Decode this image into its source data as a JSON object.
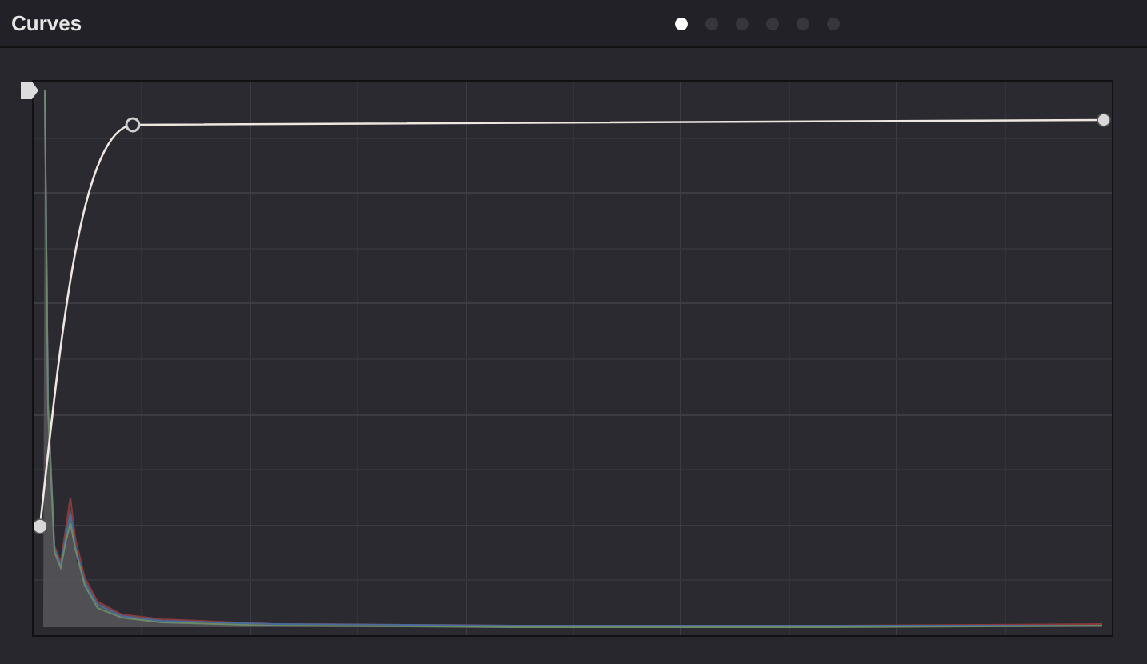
{
  "panel": {
    "title": "Curves"
  },
  "pages": [
    {
      "selected": true
    },
    {
      "selected": false
    },
    {
      "selected": false
    },
    {
      "selected": false
    },
    {
      "selected": false
    },
    {
      "selected": false
    }
  ]
}
